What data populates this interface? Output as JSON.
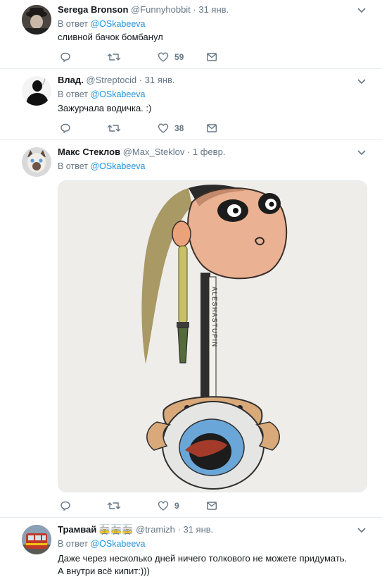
{
  "tweets": [
    {
      "name": "Serega Bronson",
      "handle": "@Funnyhobbit",
      "time": "· 31 янв.",
      "reply_prefix": "В ответ",
      "reply_to": "@OSkabeeva",
      "text": "сливной бачок бомбанул",
      "likes": "59"
    },
    {
      "name": "Влад.",
      "handle": "@Streptocid",
      "time": "· 31 янв.",
      "reply_prefix": "В ответ",
      "reply_to": "@OSkabeeva",
      "text": "Зажурчала водичка. :)",
      "likes": "38"
    },
    {
      "name": "Макс Стеклов",
      "handle": "@Max_Steklov",
      "time": "· 1 февр.",
      "reply_prefix": "В ответ",
      "reply_to": "@OSkabeeva",
      "image_text": "ALESHASTUPIN",
      "likes": "9"
    },
    {
      "name": "Трамвай 🚋🚋🚋",
      "handle": "@tramizh",
      "time": "· 31 янв.",
      "reply_prefix": "В ответ",
      "reply_to": "@OSkabeeva",
      "text_line1": "Даже через несколько дней ничего толкового не можете придумать.",
      "text_line2": "А внутри всё кипит:)))"
    }
  ],
  "colors": {
    "accent": "#1b95e0",
    "secondary_text": "#657786",
    "divider": "#e6ecf0"
  },
  "icons": [
    "chevron-down-icon",
    "reply-icon",
    "retweet-icon",
    "like-icon",
    "message-icon"
  ]
}
